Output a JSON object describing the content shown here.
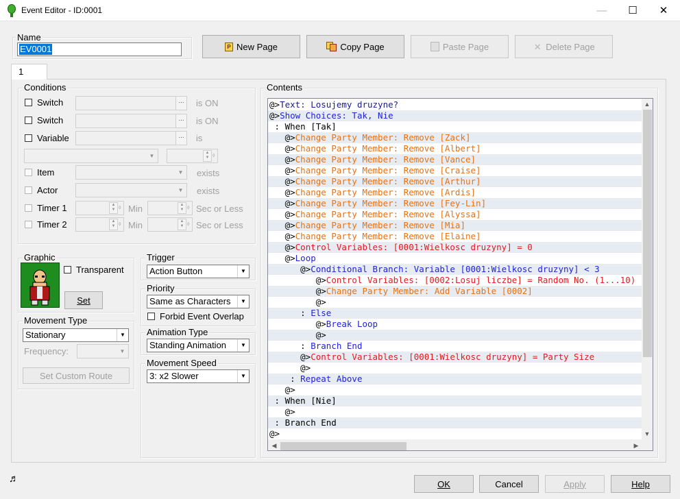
{
  "window": {
    "title": "Event Editor - ID:0001",
    "minimize": "—",
    "maximize": "☐",
    "close": "✕"
  },
  "name_group": {
    "legend": "Name",
    "value": "EV0001"
  },
  "page_buttons": {
    "new_page": "New Page",
    "copy_page": "Copy Page",
    "paste_page": "Paste Page",
    "delete_page": "Delete Page"
  },
  "tabs": [
    "1"
  ],
  "conditions": {
    "legend": "Conditions",
    "switch1": {
      "label": "Switch",
      "suffix": "is ON"
    },
    "switch2": {
      "label": "Switch",
      "suffix": "is ON"
    },
    "variable": {
      "label": "Variable",
      "suffix": "is"
    },
    "item": {
      "label": "Item",
      "suffix": "exists"
    },
    "actor": {
      "label": "Actor",
      "suffix": "exists"
    },
    "timer1": {
      "label": "Timer 1",
      "min": "Min",
      "sec": "Sec or Less"
    },
    "timer2": {
      "label": "Timer 2",
      "min": "Min",
      "sec": "Sec or Less"
    }
  },
  "graphic": {
    "legend": "Graphic",
    "transparent": "Transparent",
    "set": "Set"
  },
  "trigger": {
    "legend": "Trigger",
    "value": "Action Button"
  },
  "priority": {
    "legend": "Priority",
    "value": "Same as Characters",
    "forbid_overlap": "Forbid Event Overlap"
  },
  "movement_type": {
    "legend": "Movement Type",
    "value": "Stationary",
    "frequency_label": "Frequency:",
    "set_custom_route": "Set Custom Route"
  },
  "animation_type": {
    "legend": "Animation Type",
    "value": "Standing Animation"
  },
  "movement_speed": {
    "legend": "Movement Speed",
    "value": "3: x2 Slower"
  },
  "contents": {
    "legend": "Contents",
    "lines": [
      {
        "indent": "",
        "prefix": "@>",
        "text": "Text: Losujemy druzyne?",
        "color": "navy"
      },
      {
        "indent": "",
        "prefix": "@>",
        "text": "Show Choices: Tak, Nie",
        "color": "blue"
      },
      {
        "indent": " : ",
        "prefix": "",
        "text": "When [Tak]",
        "color": "black"
      },
      {
        "indent": "   ",
        "prefix": "@>",
        "text": "Change Party Member: Remove [Zack]",
        "color": "orange"
      },
      {
        "indent": "   ",
        "prefix": "@>",
        "text": "Change Party Member: Remove [Albert]",
        "color": "orange"
      },
      {
        "indent": "   ",
        "prefix": "@>",
        "text": "Change Party Member: Remove [Vance]",
        "color": "orange"
      },
      {
        "indent": "   ",
        "prefix": "@>",
        "text": "Change Party Member: Remove [Craise]",
        "color": "orange"
      },
      {
        "indent": "   ",
        "prefix": "@>",
        "text": "Change Party Member: Remove [Arthur]",
        "color": "orange"
      },
      {
        "indent": "   ",
        "prefix": "@>",
        "text": "Change Party Member: Remove [Ardis]",
        "color": "orange"
      },
      {
        "indent": "   ",
        "prefix": "@>",
        "text": "Change Party Member: Remove [Fey-Lin]",
        "color": "orange"
      },
      {
        "indent": "   ",
        "prefix": "@>",
        "text": "Change Party Member: Remove [Alyssa]",
        "color": "orange"
      },
      {
        "indent": "   ",
        "prefix": "@>",
        "text": "Change Party Member: Remove [Mia]",
        "color": "orange"
      },
      {
        "indent": "   ",
        "prefix": "@>",
        "text": "Change Party Member: Remove [Elaine]",
        "color": "orange"
      },
      {
        "indent": "   ",
        "prefix": "@>",
        "text": "Control Variables: [0001:Wielkosc druzyny] = 0",
        "color": "red"
      },
      {
        "indent": "   ",
        "prefix": "@>",
        "text": "Loop",
        "color": "blue"
      },
      {
        "indent": "      ",
        "prefix": "@>",
        "text": "Conditional Branch: Variable [0001:Wielkosc druzyny] < 3",
        "color": "blue"
      },
      {
        "indent": "         ",
        "prefix": "@>",
        "text": "Control Variables: [0002:Losuj liczbe] = Random No. (1...10)",
        "color": "red"
      },
      {
        "indent": "         ",
        "prefix": "@>",
        "text": "Change Party Member: Add Variable [0002]",
        "color": "orange"
      },
      {
        "indent": "         ",
        "prefix": "@>",
        "text": "",
        "color": "black"
      },
      {
        "indent": "      : ",
        "prefix": "",
        "text": "Else",
        "color": "blue"
      },
      {
        "indent": "         ",
        "prefix": "@>",
        "text": "Break Loop",
        "color": "blue"
      },
      {
        "indent": "         ",
        "prefix": "@>",
        "text": "",
        "color": "black"
      },
      {
        "indent": "      : ",
        "prefix": "",
        "text": "Branch End",
        "color": "blue"
      },
      {
        "indent": "      ",
        "prefix": "@>",
        "text": "Control Variables: [0001:Wielkosc druzyny] = Party Size",
        "color": "red"
      },
      {
        "indent": "      ",
        "prefix": "@>",
        "text": "",
        "color": "black"
      },
      {
        "indent": "    : ",
        "prefix": "",
        "text": "Repeat Above",
        "color": "blue"
      },
      {
        "indent": "   ",
        "prefix": "@>",
        "text": "",
        "color": "black"
      },
      {
        "indent": " : ",
        "prefix": "",
        "text": "When [Nie]",
        "color": "black"
      },
      {
        "indent": "   ",
        "prefix": "@>",
        "text": "",
        "color": "black"
      },
      {
        "indent": " : ",
        "prefix": "",
        "text": "Branch End",
        "color": "black"
      },
      {
        "indent": "",
        "prefix": "@>",
        "text": "",
        "color": "black"
      }
    ]
  },
  "footer": {
    "ok": "OK",
    "cancel": "Cancel",
    "apply": "Apply",
    "help": "Help"
  }
}
